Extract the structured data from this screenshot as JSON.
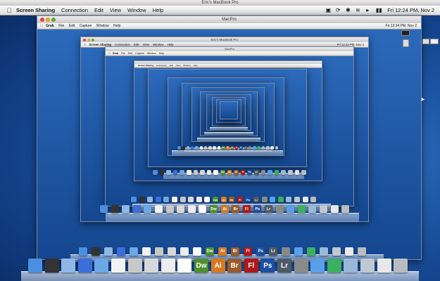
{
  "window": {
    "title": "Eric's MacBook Pro"
  },
  "menubar": {
    "app_name": "Screen Sharing",
    "items": [
      "Connection",
      "Edit",
      "View",
      "Window",
      "Help"
    ],
    "clock": "Fri 12:24 PM, Nov 2"
  },
  "remote_window": {
    "title": "MacPro",
    "menu_app": "Grab",
    "menu_items": [
      "File",
      "Edit",
      "Capture",
      "Window",
      "Help"
    ],
    "clock": "Fri 12:24 PM, Nov 2"
  },
  "nested_window_2": {
    "title": "Eric's MacBook Pro",
    "menu_app": "Screen Sharing",
    "menu_items": [
      "Connection",
      "Edit",
      "View",
      "Window",
      "Help"
    ],
    "clock": "Fri 12:24 PM, Nov 2"
  },
  "nested_window_3": {
    "title": "MacPro",
    "menu_app": "Grab",
    "menu_items": [
      "File",
      "Edit",
      "Capture",
      "Window",
      "Help"
    ]
  },
  "nested_window_4": {
    "menu_app": "Screen Sharing",
    "menu_items": [
      "Connection",
      "Edit",
      "View",
      "Window",
      "Help"
    ]
  },
  "dock": {
    "apps": [
      {
        "label": "",
        "icon": "finder-icon",
        "color": "#4a8fe0"
      },
      {
        "label": "",
        "icon": "dashboard-icon",
        "color": "#333333"
      },
      {
        "label": "",
        "icon": "mail-icon",
        "color": "#8fb8e8"
      },
      {
        "label": "",
        "icon": "ichat-icon",
        "color": "#3a6ed8"
      },
      {
        "label": "",
        "icon": "itunes-icon",
        "color": "#6aa8e8"
      },
      {
        "label": "",
        "icon": "ical-icon",
        "color": "#f2f2f2"
      },
      {
        "label": "",
        "icon": "grab-icon",
        "color": "#c8c8c8"
      },
      {
        "label": "",
        "icon": "preview-icon",
        "color": "#d8d8d8"
      },
      {
        "label": "",
        "icon": "textedit-icon",
        "color": "#ececec"
      },
      {
        "label": "",
        "icon": "document-icon",
        "color": "#ffffff"
      },
      {
        "label": "Dw",
        "icon": "dreamweaver-icon",
        "color": "#4f8f2f"
      },
      {
        "label": "Ai",
        "icon": "illustrator-icon",
        "color": "#d67a20"
      },
      {
        "label": "Br",
        "icon": "bridge-icon",
        "color": "#9a5a2a"
      },
      {
        "label": "Fl",
        "icon": "flash-icon",
        "color": "#b01818"
      },
      {
        "label": "Ps",
        "icon": "photoshop-icon",
        "color": "#1e50a0"
      },
      {
        "label": "Lr",
        "icon": "lightroom-icon",
        "color": "#505a64"
      },
      {
        "label": "",
        "icon": "system-prefs-icon",
        "color": "#8a8a8a"
      },
      {
        "label": "",
        "icon": "safari-icon",
        "color": "#5aa0e8"
      },
      {
        "label": "",
        "icon": "globe-icon",
        "color": "#3ab060"
      },
      {
        "label": "",
        "icon": "folder-icon",
        "color": "#9ab8d8"
      },
      {
        "label": "",
        "icon": "stack-icon",
        "color": "#c0c8d0"
      },
      {
        "label": "",
        "icon": "document-stack-icon",
        "color": "#e8e8e8"
      },
      {
        "label": "",
        "icon": "trash-icon",
        "color": "#b8bcc0"
      }
    ]
  },
  "status_icons": [
    "screen-sharing-icon",
    "sync-icon",
    "bluetooth-icon",
    "wifi-icon",
    "volume-icon",
    "battery-icon"
  ]
}
